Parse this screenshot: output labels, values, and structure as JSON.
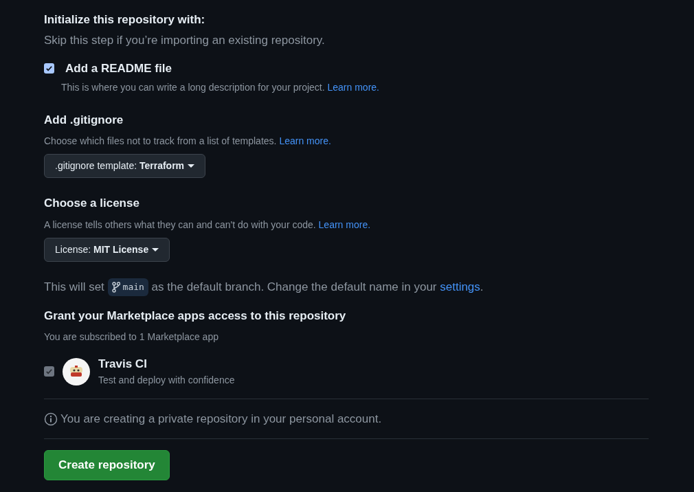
{
  "init": {
    "heading": "Initialize this repository with:",
    "note": "Skip this step if you’re importing an existing repository."
  },
  "readme": {
    "label": "Add a README file",
    "checked": true,
    "description": "This is where you can write a long description for your project.",
    "link": "Learn more."
  },
  "gitignore": {
    "heading": "Add .gitignore",
    "description": "Choose which files not to track from a list of templates.",
    "link": "Learn more.",
    "button": ".gitignore template: **Terraform**"
  },
  "license": {
    "heading": "Choose a license",
    "description": "A license tells others what they can and can't do with your code.",
    "link": "Learn more.",
    "button": "License: **MIT License**"
  },
  "branch_note": {
    "before": "This will set",
    "branch": "main",
    "after": "as the default branch. Change the default name in your",
    "link": "settings",
    "end": "."
  },
  "marketplace": {
    "heading": "Grant your Marketplace apps access to this repository",
    "note": "You are subscribed to 1 Marketplace app",
    "apps": [
      {
        "name": "Travis CI",
        "description": "Test and deploy with confidence",
        "checked": true,
        "disabled": true
      }
    ]
  },
  "info": "You are creating a private repository in your personal account.",
  "submit": "Create repository"
}
